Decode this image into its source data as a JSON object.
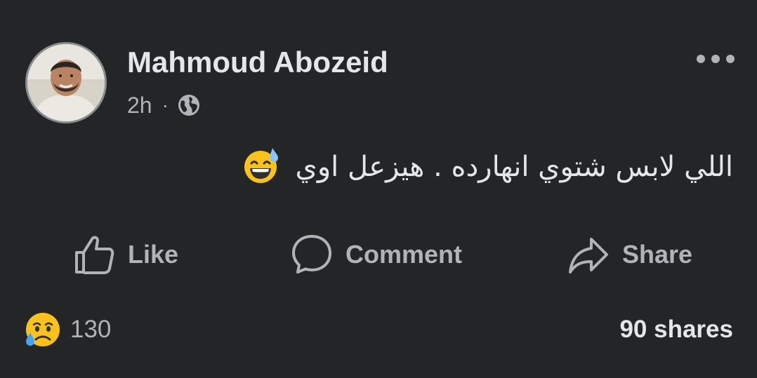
{
  "post": {
    "author_name": "Mahmoud Abozeid",
    "time": "2h",
    "separator": "·",
    "audience_icon": "globe-icon",
    "menu_icon": "more-horizontal-icon",
    "text": "اللي لابس شتوي انهارده . هيزعل اوي",
    "text_emoji": "sweat-smile-emoji"
  },
  "actions": {
    "like_label": "Like",
    "like_icon": "thumbs-up-icon",
    "comment_label": "Comment",
    "comment_icon": "speech-bubble-icon",
    "share_label": "Share",
    "share_icon": "share-arrow-icon"
  },
  "footer": {
    "reaction_icon": "sad-tear-reaction-icon",
    "reaction_count": "130",
    "shares_text": "90 shares"
  },
  "colors": {
    "background": "#242526",
    "primary_text": "#e4e6eb",
    "secondary_text": "#b0b3b8",
    "emoji_yellow": "#fcc21b"
  }
}
